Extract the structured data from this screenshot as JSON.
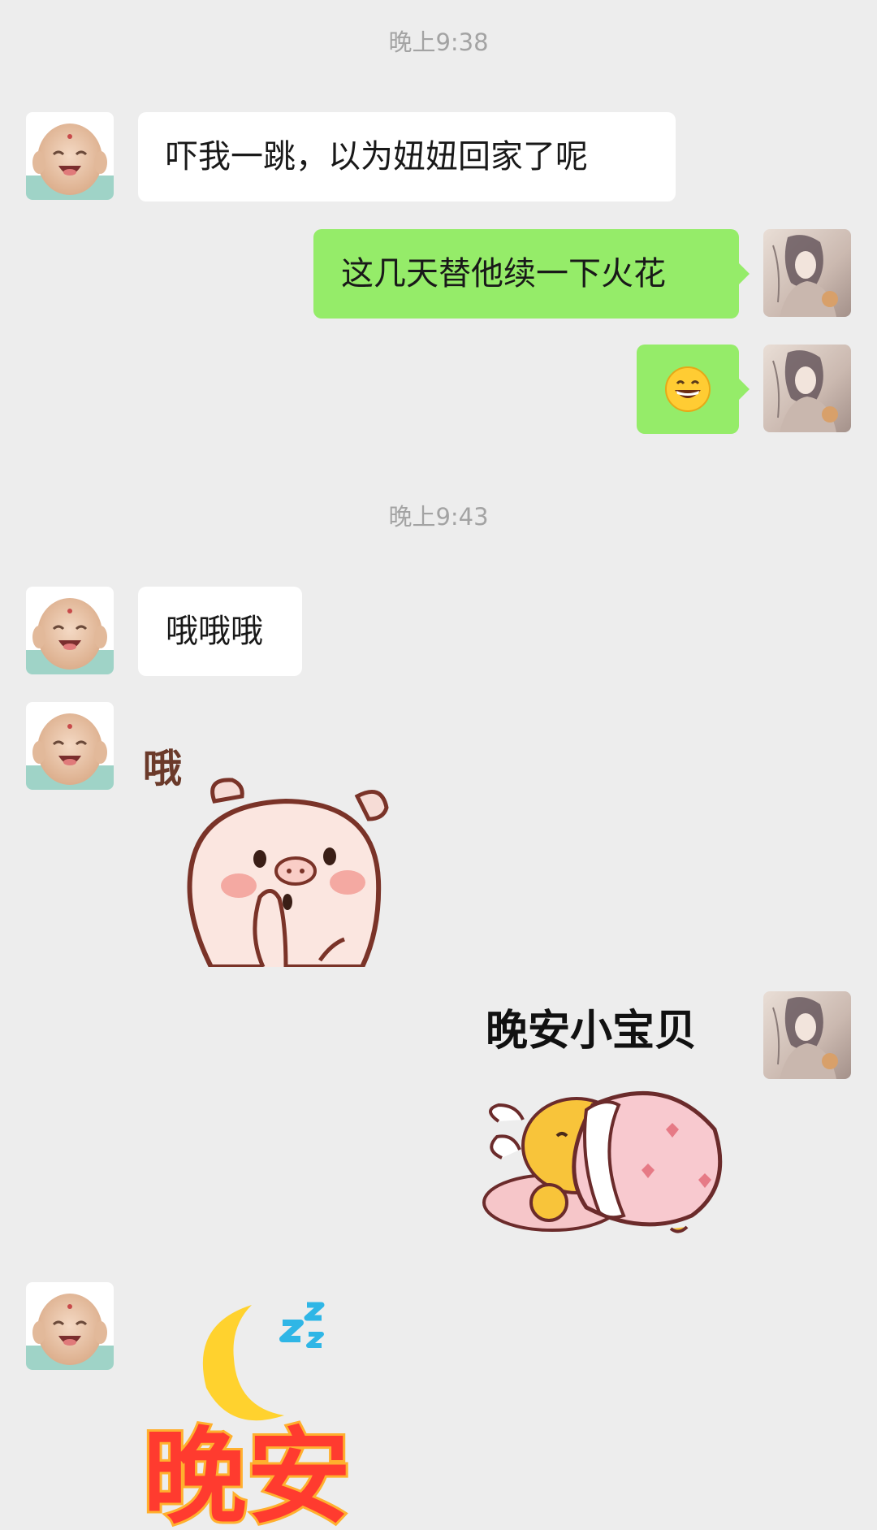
{
  "chat": {
    "time_1": "晚上9:38",
    "time_2": "晚上9:43",
    "msg_1": "吓我一跳，以为妞妞回家了呢",
    "msg_2": "这几天替他续一下火花",
    "msg_3_emoji": "😄",
    "msg_4": "哦哦哦",
    "sticker_1_text": "哦",
    "sticker_2_text": "晚安小宝贝",
    "sticker_3_text": "晚安"
  },
  "colors": {
    "background": "#ededed",
    "incoming_bubble": "#ffffff",
    "outgoing_bubble": "#95ec69",
    "timestamp": "#a3a3a3"
  },
  "icons": {
    "left_avatar": "smiling-buddha-avatar",
    "right_avatar": "ink-painting-portrait-avatar",
    "sticker_1": "blushing-pig-sticker",
    "sticker_2": "sleeping-chick-under-blanket-sticker",
    "sticker_3": "moon-and-zzz-sticker"
  }
}
